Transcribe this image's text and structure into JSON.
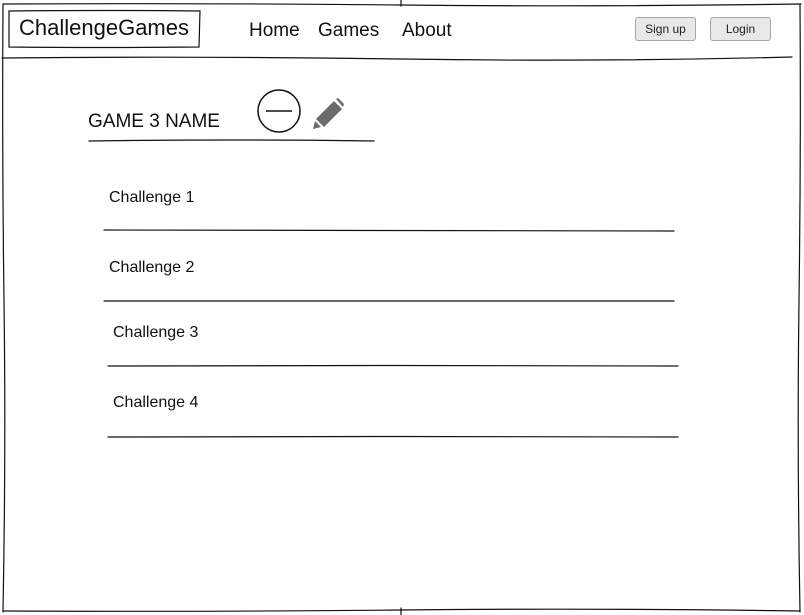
{
  "header": {
    "brand": "ChallengeGames",
    "nav": {
      "home": "Home",
      "games": "Games",
      "about": "About"
    },
    "buttons": {
      "signup": "Sign up",
      "login": "Login"
    }
  },
  "main": {
    "game_title": "GAME 3 NAME",
    "icons": {
      "remove": "minus-circle-icon",
      "edit": "pencil-icon"
    },
    "challenges": [
      "Challenge 1",
      "Challenge 2",
      "Challenge 3",
      "Challenge 4"
    ]
  },
  "colors": {
    "ink": "#111111",
    "button_bg": "#e8e8e8",
    "button_border": "#a6a6a6",
    "icon_gray": "#6b6b6b"
  }
}
